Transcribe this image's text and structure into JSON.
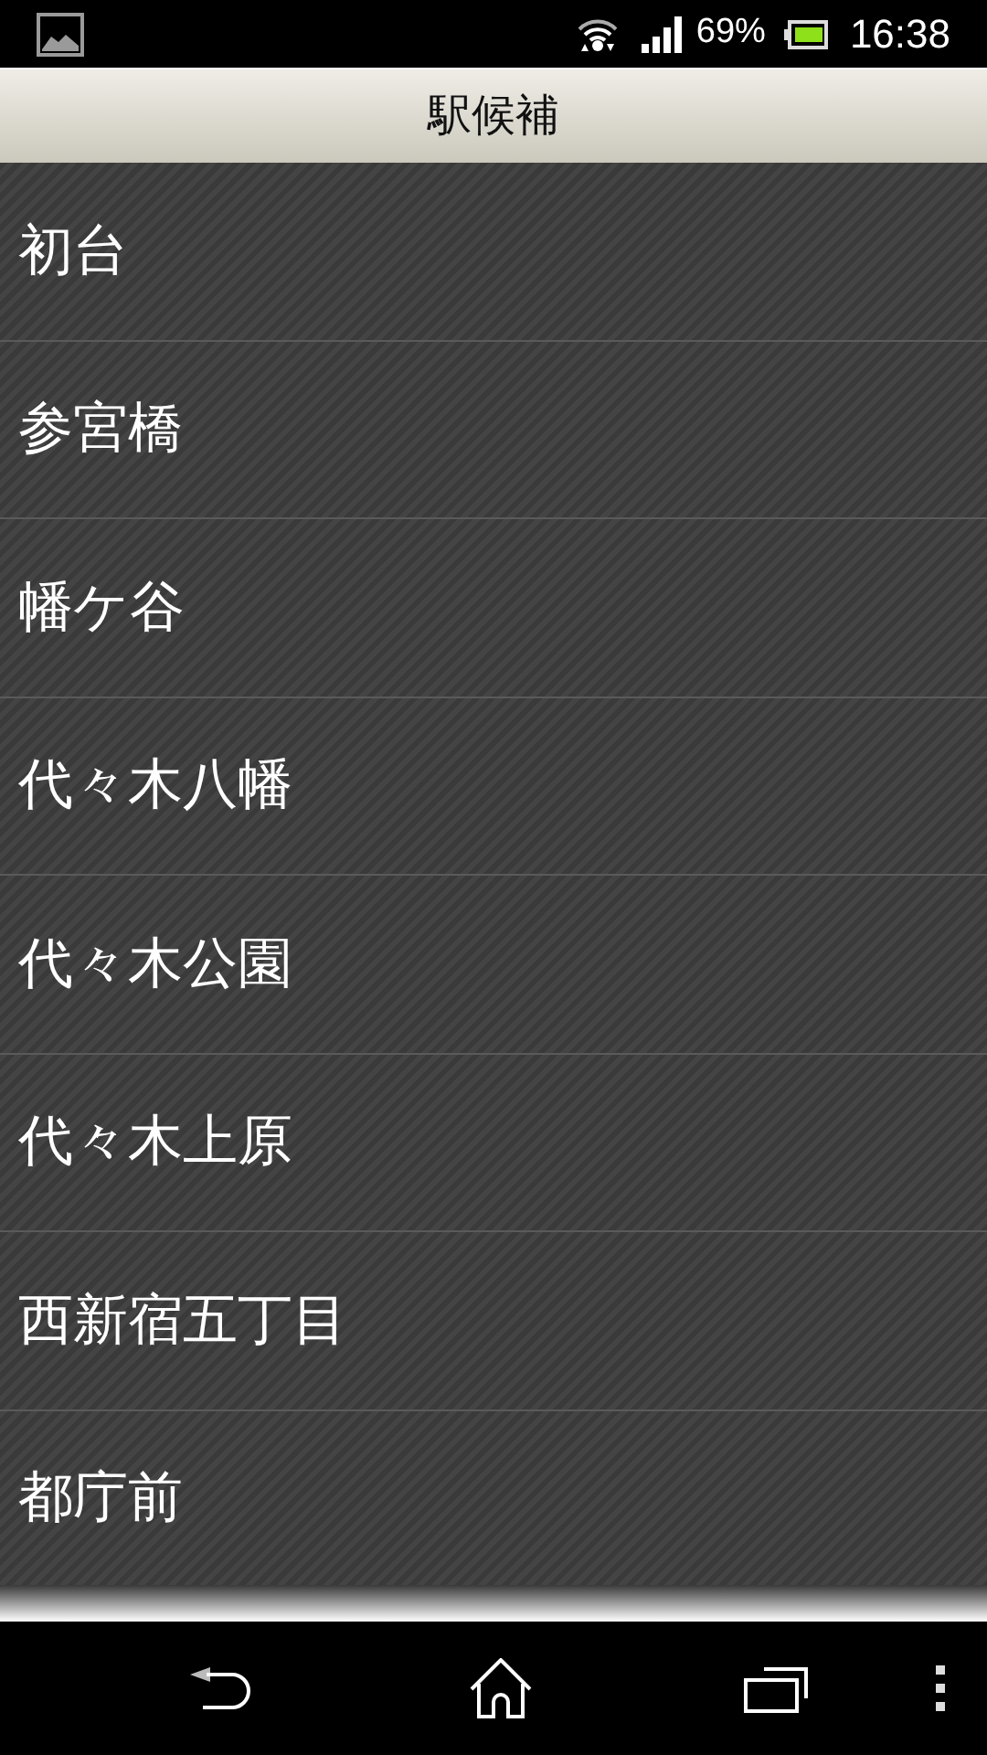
{
  "status_bar": {
    "battery": "69%",
    "time": "16:38"
  },
  "header": {
    "title": "駅候補"
  },
  "stations": [
    {
      "name": "初台"
    },
    {
      "name": "参宮橋"
    },
    {
      "name": "幡ケ谷"
    },
    {
      "name": "代々木八幡"
    },
    {
      "name": "代々木公園"
    },
    {
      "name": "代々木上原"
    },
    {
      "name": "西新宿五丁目"
    },
    {
      "name": "都庁前"
    }
  ]
}
